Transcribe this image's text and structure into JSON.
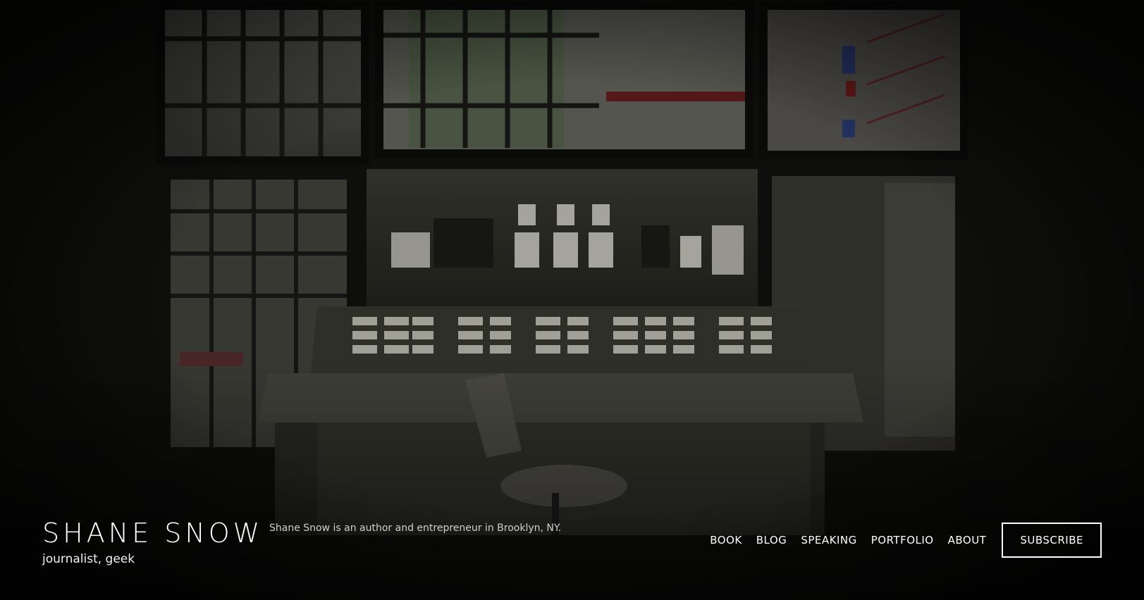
{
  "site": {
    "title": "SHANE SNOW",
    "tagline": "journalist, geek",
    "description": "Shane Snow is an author and entrepreneur in Brooklyn, NY."
  },
  "nav": {
    "items": [
      {
        "label": "BOOK"
      },
      {
        "label": "BLOG"
      },
      {
        "label": "SPEAKING"
      },
      {
        "label": "PORTFOLIO"
      },
      {
        "label": "ABOUT"
      }
    ],
    "subscribe_label": "SUBSCRIBE"
  },
  "hero": {
    "image": "abandoned-control-room-photo"
  }
}
